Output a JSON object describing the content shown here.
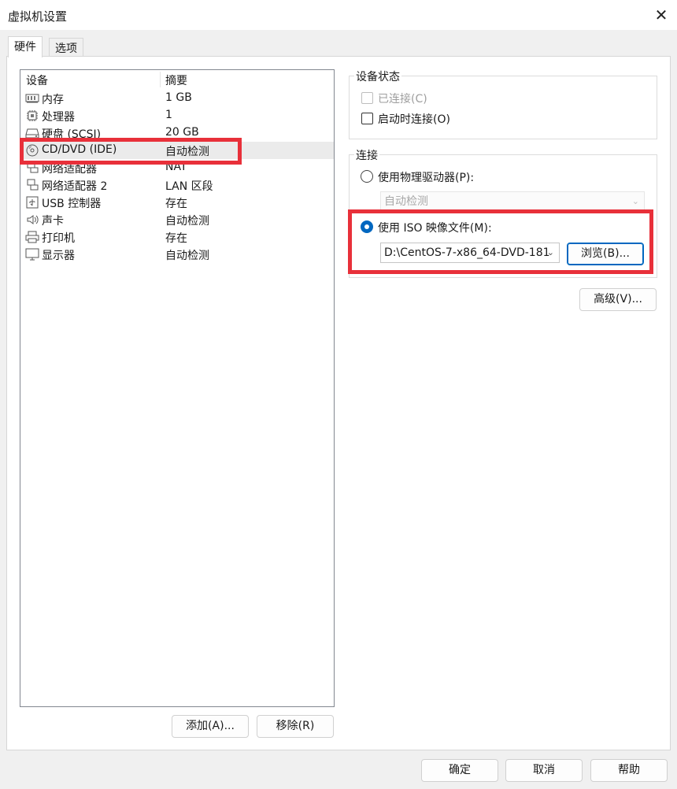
{
  "window": {
    "title": "虚拟机设置",
    "close_label": "✕"
  },
  "tabs": [
    {
      "label": "硬件",
      "active": true
    },
    {
      "label": "选项",
      "active": false
    }
  ],
  "device_list": {
    "columns": [
      "设备",
      "摘要"
    ],
    "rows": [
      {
        "name": "内存",
        "summary": "1 GB",
        "icon": "memory-icon"
      },
      {
        "name": "处理器",
        "summary": "1",
        "icon": "processor-icon"
      },
      {
        "name": "硬盘 (SCSI)",
        "summary": "20 GB",
        "icon": "hard-disk-icon"
      },
      {
        "name": "CD/DVD (IDE)",
        "summary": "自动检测",
        "icon": "cd-dvd-icon",
        "selected": true
      },
      {
        "name": "网络适配器",
        "summary": "NAT",
        "icon": "network-adapter-icon"
      },
      {
        "name": "网络适配器 2",
        "summary": "LAN 区段",
        "icon": "network-adapter-icon"
      },
      {
        "name": "USB 控制器",
        "summary": "存在",
        "icon": "usb-icon"
      },
      {
        "name": "声卡",
        "summary": "自动检测",
        "icon": "speaker-icon"
      },
      {
        "name": "打印机",
        "summary": "存在",
        "icon": "printer-icon"
      },
      {
        "name": "显示器",
        "summary": "自动检测",
        "icon": "monitor-icon"
      }
    ],
    "add_button": "添加(A)...",
    "remove_button": "移除(R)"
  },
  "device_status": {
    "title": "设备状态",
    "connected_label": "已连接(C)",
    "connected_checked": false,
    "connect_on_power_label": "启动时连接(O)",
    "connect_on_power_checked": false
  },
  "connection": {
    "title": "连接",
    "physical_drive_label": "使用物理驱动器(P):",
    "physical_drive_value": "自动检测",
    "iso_label": "使用 ISO 映像文件(M):",
    "iso_path": "D:\\CentOS-7-x86_64-DVD-181",
    "browse_button": "浏览(B)...",
    "selected": "iso"
  },
  "advanced_button": "高级(V)...",
  "footer": {
    "ok": "确定",
    "cancel": "取消",
    "help": "帮助"
  },
  "colors": {
    "accent": "#0067c0",
    "highlight": "#e8303a"
  }
}
